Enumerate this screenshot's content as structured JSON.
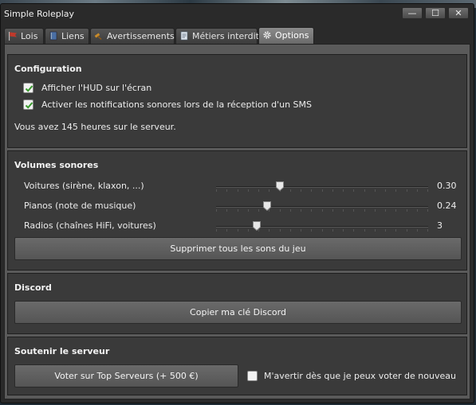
{
  "window": {
    "title": "Simple Roleplay",
    "minimize_glyph": "—",
    "maximize_glyph": "☐",
    "close_glyph": "✕"
  },
  "tabs": [
    {
      "label": "Lois",
      "icon": "flag-icon"
    },
    {
      "label": "Liens",
      "icon": "book-icon"
    },
    {
      "label": "Avertissements",
      "icon": "gavel-icon"
    },
    {
      "label": "Métiers interdits",
      "icon": "document-icon"
    },
    {
      "label": "Options",
      "icon": "gear-icon",
      "active": true
    }
  ],
  "config": {
    "title": "Configuration",
    "options": [
      {
        "label": "Afficher l'HUD sur l'écran",
        "checked": true
      },
      {
        "label": "Activer les notifications sonores lors de la réception d'un SMS",
        "checked": true
      }
    ],
    "hours_text": "Vous avez 145 heures sur le serveur."
  },
  "volumes": {
    "title": "Volumes sonores",
    "sliders": [
      {
        "label": "Voitures (sirène, klaxon, ...)",
        "value_text": "0.30",
        "fraction": 0.3
      },
      {
        "label": "Pianos (note de musique)",
        "value_text": "0.24",
        "fraction": 0.24
      },
      {
        "label": "Radios (chaînes HiFi, voitures)",
        "value_text": "3",
        "fraction": 0.19
      }
    ],
    "mute_button": "Supprimer tous les sons du jeu"
  },
  "discord": {
    "title": "Discord",
    "copy_button": "Copier ma clé Discord"
  },
  "support": {
    "title": "Soutenir le serveur",
    "vote_button": "Voter sur Top Serveurs (+ 500 €)",
    "notify_label": "M'avertir dès que je peux voter de nouveau",
    "notify_checked": false
  },
  "colors": {
    "check_green": "#3a9a2e",
    "panel": "#3a3a3a",
    "active_tab": "#7a7a7a"
  }
}
